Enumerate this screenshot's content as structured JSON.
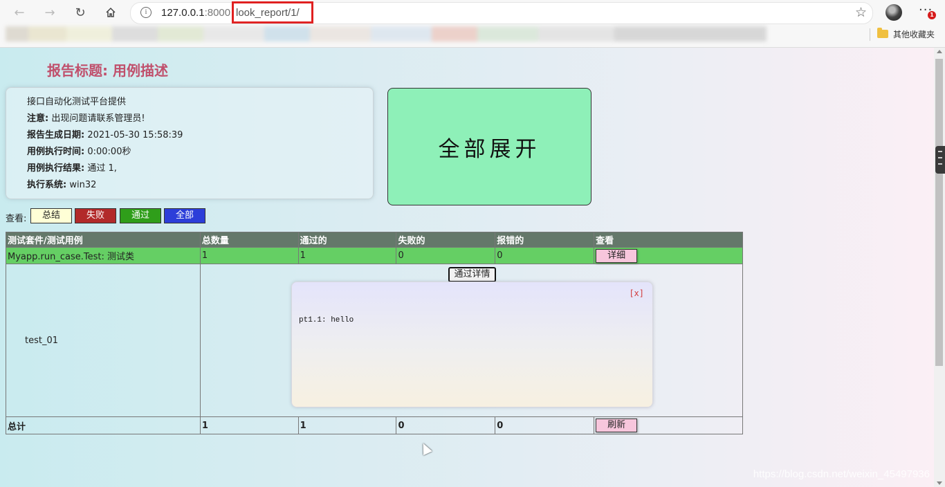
{
  "browser": {
    "url_host": "127.0.0.1",
    "url_port": ":8000",
    "url_path": "look_report/1/",
    "other_bookmarks": "其他收藏夹",
    "notification_count": "1"
  },
  "report": {
    "title": "报告标题: 用例描述",
    "info": {
      "provider": "接口自动化测试平台提供",
      "notice_label": "注意:",
      "notice_value": "出现问题请联系管理员!",
      "date_label": "报告生成日期:",
      "date_value": "2021-05-30 15:58:39",
      "duration_label": "用例执行时间:",
      "duration_value": "0:00:00秒",
      "result_label": "用例执行结果:",
      "result_value": "通过 1,",
      "system_label": "执行系统:",
      "system_value": "win32"
    },
    "expand_all": "全部展开",
    "view_label": "查看:",
    "filters": [
      {
        "label": "总结",
        "color": "#ffffd6"
      },
      {
        "label": "失败",
        "color": "#b22a2a"
      },
      {
        "label": "通过",
        "color": "#2f9e1a"
      },
      {
        "label": "全部",
        "color": "#2c3ed9"
      }
    ]
  },
  "table": {
    "headers": [
      "测试套件/测试用例",
      "总数量",
      "通过的",
      "失败的",
      "报错的",
      "查看"
    ],
    "suite": {
      "name": "Myapp.run_case.Test: 测试类",
      "total": "1",
      "passed": "1",
      "failed": "0",
      "errors": "0",
      "detail_button": "详细"
    },
    "case": {
      "name": "test_01",
      "pass_detail_button": "通过详情",
      "popup_close": "[x]",
      "popup_output": "pt1.1: hello"
    },
    "total": {
      "label": "总计",
      "total": "1",
      "passed": "1",
      "failed": "0",
      "errors": "0",
      "refresh_button": "刷新"
    }
  },
  "watermark": "https://blog.csdn.net/weixin_45497936"
}
